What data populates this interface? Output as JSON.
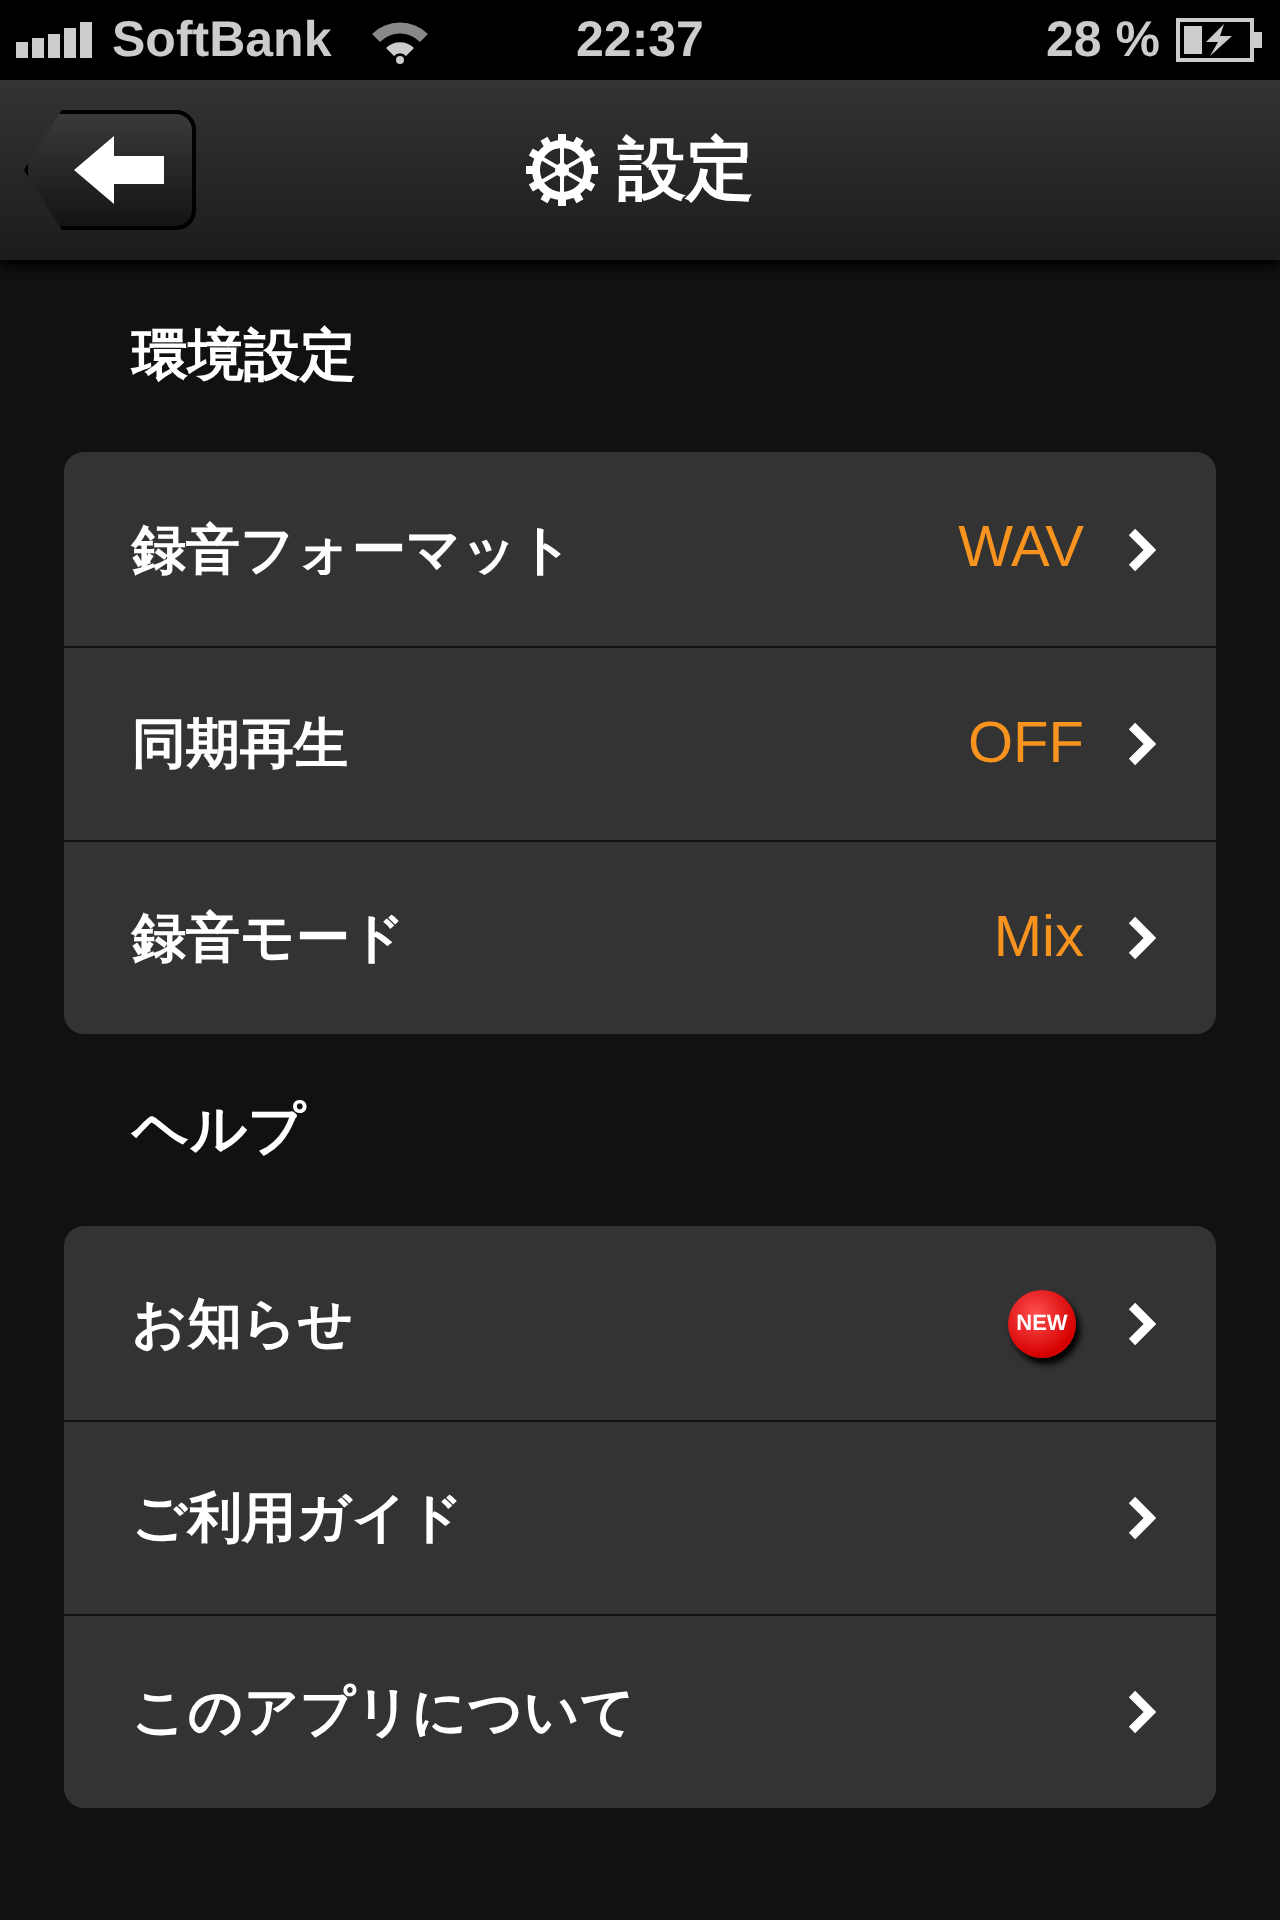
{
  "status_bar": {
    "carrier": "SoftBank",
    "time": "22:37",
    "battery": "28 %"
  },
  "nav_bar": {
    "title": "設定"
  },
  "sections": [
    {
      "header": "環境設定",
      "rows": [
        {
          "label": "録音フォーマット",
          "value": "WAV"
        },
        {
          "label": "同期再生",
          "value": "OFF"
        },
        {
          "label": "録音モード",
          "value": "Mix"
        }
      ]
    },
    {
      "header": "ヘルプ",
      "rows": [
        {
          "label": "お知らせ",
          "badge": "NEW"
        },
        {
          "label": "ご利用ガイド"
        },
        {
          "label": "このアプリについて"
        }
      ]
    }
  ]
}
